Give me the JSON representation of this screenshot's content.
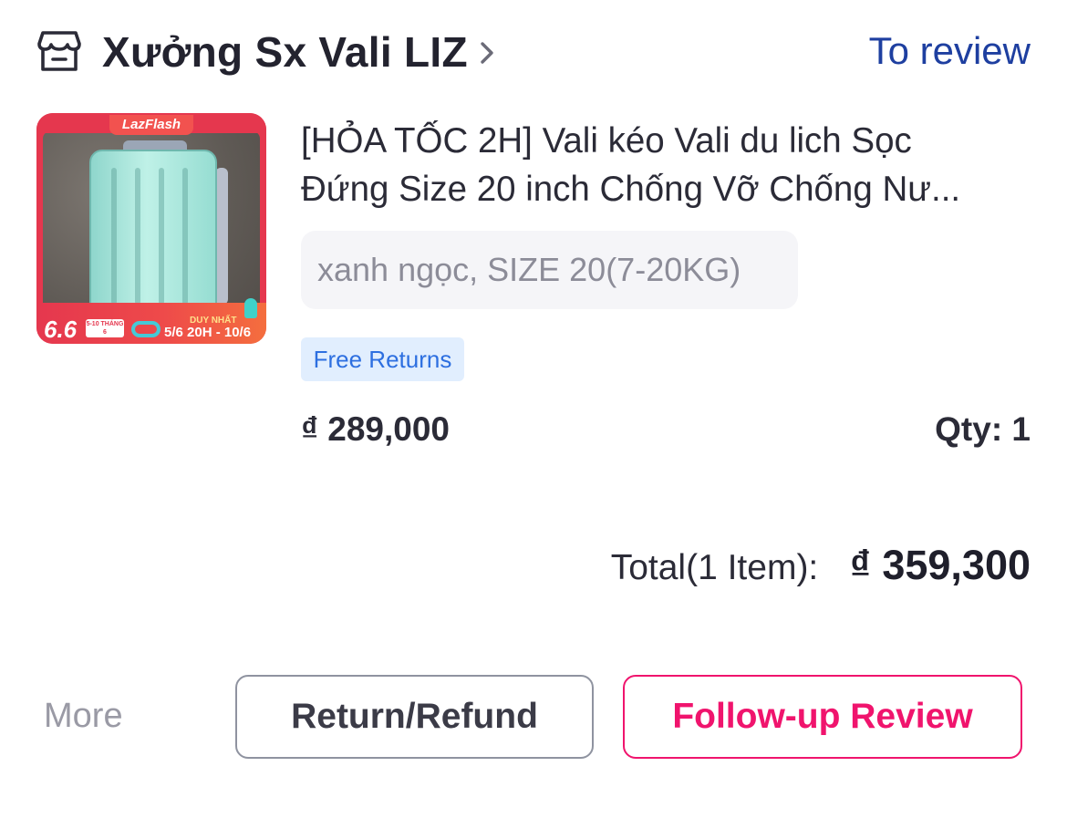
{
  "store": {
    "name": "Xưởng Sx Vali LIZ",
    "icon": "store-icon",
    "chevron_icon": "chevron-right-icon",
    "status_link": "To review"
  },
  "product": {
    "image": {
      "badge": "LazFlash",
      "promo_big": "6.6",
      "promo_days": "5-10 THÁNG 6",
      "promo_tag": "DUY NHẤT",
      "promo_date": "5/6 20H - 10/6"
    },
    "title_line1": "[HỎA TỐC 2H] Vali kéo Vali du lich Sọc",
    "title_line2": "Đứng Size 20 inch Chống Vỡ Chống Nư...",
    "variant": "xanh ngọc, SIZE 20(7-20KG)",
    "badge": "Free Returns",
    "price": "₫ 289,000",
    "qty": "Qty: 1"
  },
  "summary": {
    "total_label": "Total(1 Item):",
    "total_value": "₫ 359,300"
  },
  "actions": {
    "more": "More",
    "refund": "Return/Refund",
    "review": "Follow-up Review"
  },
  "colors": {
    "link_blue": "#1e3fa0",
    "accent_pink": "#f0146d",
    "badge_blue_bg": "#e1eefe",
    "badge_blue_text": "#2d6fe0"
  }
}
